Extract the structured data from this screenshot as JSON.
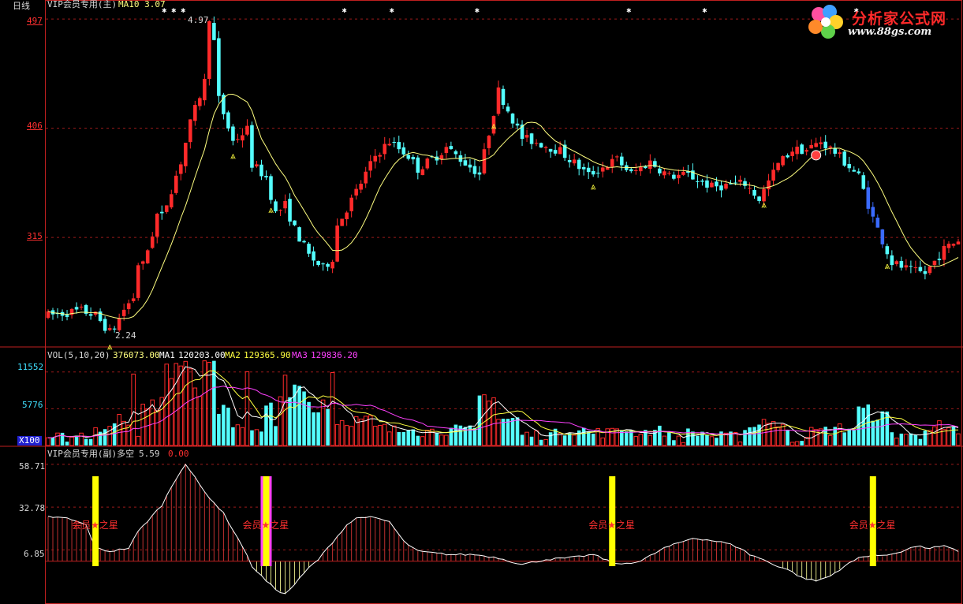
{
  "colors": {
    "up": "#ff2a2a",
    "down": "#54ffff",
    "down_special": "#3a6bff",
    "ma": "#ffff80",
    "grid": "#9b1b1b",
    "border": "#c02020",
    "yellow": "#ffff00",
    "magenta": "#ff40ff"
  },
  "main_panel": {
    "period": "日线",
    "indicator_title": "VIP会员专用(主)",
    "ma_label": "MA10 3.07",
    "y_ticks": [
      "497",
      "406",
      "315"
    ],
    "high_label": "4.97",
    "low_label": "2.24"
  },
  "volume_panel": {
    "title": "VOL(5,10,20)",
    "vol_value": "376073.00",
    "ma1_label": "MA1",
    "ma1_value": "120203.00",
    "ma2_label": "MA2",
    "ma2_value": "129365.90",
    "ma3_label": "MA3",
    "ma3_value": "129836.20",
    "y_ticks": [
      "11552",
      "5776"
    ],
    "unit": "X100"
  },
  "sub_panel": {
    "title": "VIP会员专用(副)多空",
    "value": "5.59",
    "value2": "0.00",
    "y_ticks": [
      "58.71",
      "32.78",
      "6.85"
    ],
    "star_label": "会员★之星"
  },
  "logo": {
    "title": "分析家公式网",
    "url": "www.88gs.com"
  },
  "chart_data": {
    "type": "candlestick",
    "n_bars": 193,
    "price_axis": {
      "ticks": [
        497,
        406,
        315
      ],
      "unit": "price x0.01",
      "ylim": [
        225,
        505
      ]
    },
    "price_path": [
      [
        0,
        250
      ],
      [
        7,
        254
      ],
      [
        10,
        250
      ],
      [
        13,
        236
      ],
      [
        14,
        240
      ],
      [
        16,
        255
      ],
      [
        18,
        265
      ],
      [
        19,
        293
      ],
      [
        20,
        292
      ],
      [
        22,
        318
      ],
      [
        23,
        334
      ],
      [
        24,
        332
      ],
      [
        28,
        378
      ],
      [
        30,
        410
      ],
      [
        33,
        445
      ],
      [
        34,
        499
      ],
      [
        35,
        478
      ],
      [
        36,
        430
      ],
      [
        39,
        395
      ],
      [
        42,
        405
      ],
      [
        43,
        376
      ],
      [
        46,
        365
      ],
      [
        48,
        335
      ],
      [
        50,
        342
      ],
      [
        52,
        322
      ],
      [
        55,
        300
      ],
      [
        58,
        289
      ],
      [
        60,
        298
      ],
      [
        61,
        325
      ],
      [
        65,
        353
      ],
      [
        69,
        383
      ],
      [
        72,
        395
      ],
      [
        76,
        383
      ],
      [
        78,
        372
      ],
      [
        82,
        383
      ],
      [
        84,
        390
      ],
      [
        88,
        377
      ],
      [
        91,
        368
      ],
      [
        95,
        437
      ],
      [
        100,
        398
      ],
      [
        104,
        393
      ],
      [
        108,
        387
      ],
      [
        114,
        367
      ],
      [
        120,
        380
      ],
      [
        123,
        368
      ],
      [
        127,
        378
      ],
      [
        131,
        366
      ],
      [
        135,
        367
      ],
      [
        140,
        357
      ],
      [
        147,
        360
      ],
      [
        150,
        347
      ],
      [
        154,
        376
      ],
      [
        157,
        388
      ],
      [
        160,
        388
      ],
      [
        163,
        395
      ],
      [
        166,
        386
      ],
      [
        171,
        366
      ],
      [
        174,
        331
      ],
      [
        178,
        294
      ],
      [
        182,
        287
      ],
      [
        185,
        285
      ],
      [
        189,
        305
      ],
      [
        192,
        313
      ]
    ],
    "volume_axis": {
      "ticks": [
        11552,
        5776
      ],
      "unit": "X100"
    },
    "volume_series": {
      "VOL": 376073.0,
      "MA1": 120203.0,
      "MA2": 129365.9,
      "MA3": 129836.2
    },
    "sub_indicator": {
      "name": "多空",
      "ticks": [
        58.71,
        32.78,
        6.85
      ],
      "values": [
        [
          0,
          27
        ],
        [
          4,
          26
        ],
        [
          8,
          22
        ],
        [
          10,
          8
        ],
        [
          13,
          6
        ],
        [
          17,
          8
        ],
        [
          19,
          18
        ],
        [
          24,
          34
        ],
        [
          26,
          45
        ],
        [
          28,
          55
        ],
        [
          29,
          59
        ],
        [
          33,
          42
        ],
        [
          37,
          29
        ],
        [
          39,
          19
        ],
        [
          41,
          9
        ],
        [
          43,
          -3
        ],
        [
          46,
          -12
        ],
        [
          48,
          -17
        ],
        [
          50,
          -20
        ],
        [
          52,
          -14
        ],
        [
          55,
          -4
        ],
        [
          57,
          1
        ],
        [
          59,
          8
        ],
        [
          61,
          15
        ],
        [
          63,
          22
        ],
        [
          65,
          26
        ],
        [
          67,
          27
        ],
        [
          69,
          26
        ],
        [
          72,
          24
        ],
        [
          75,
          12
        ],
        [
          78,
          6
        ],
        [
          81,
          5
        ],
        [
          85,
          4
        ],
        [
          90,
          4
        ],
        [
          95,
          2
        ],
        [
          100,
          -2
        ],
        [
          105,
          1
        ],
        [
          110,
          2
        ],
        [
          115,
          4
        ],
        [
          120,
          -2
        ],
        [
          125,
          0
        ],
        [
          130,
          8
        ],
        [
          133,
          11
        ],
        [
          136,
          14
        ],
        [
          139,
          13
        ],
        [
          143,
          11
        ],
        [
          146,
          8
        ],
        [
          148,
          4
        ],
        [
          150,
          2
        ],
        [
          153,
          -2
        ],
        [
          156,
          -5
        ],
        [
          159,
          -10
        ],
        [
          162,
          -12
        ],
        [
          165,
          -9
        ],
        [
          168,
          -3
        ],
        [
          171,
          2
        ],
        [
          174,
          4
        ],
        [
          176,
          3
        ],
        [
          180,
          6
        ],
        [
          183,
          9
        ],
        [
          186,
          8
        ],
        [
          189,
          9
        ],
        [
          192,
          6
        ]
      ],
      "star_markers": [
        10,
        46,
        119,
        174
      ],
      "magenta_markers": [
        46
      ]
    },
    "markers": {
      "up_arrows": [
        13,
        39,
        47,
        94,
        115,
        151,
        177
      ],
      "smile": [
        162
      ]
    }
  }
}
